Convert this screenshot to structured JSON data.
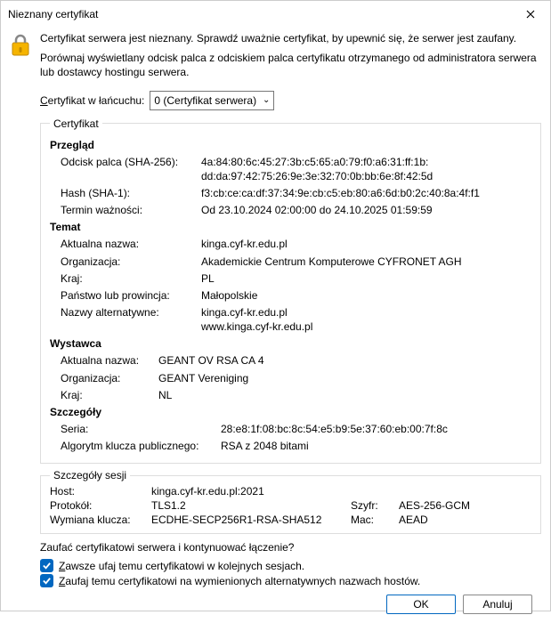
{
  "window": {
    "title": "Nieznany certyfikat"
  },
  "intro": {
    "line1": "Certyfikat serwera jest nieznany. Sprawdź uważnie certyfikat, by upewnić się, że serwer jest zaufany.",
    "line2": "Porównaj wyświetlany odcisk palca z odciskiem palca certyfikatu otrzymanego od administratora serwera lub dostawcy hostingu serwera."
  },
  "chain": {
    "label_pre": "C",
    "label_rest": "ertyfikat w łańcuchu:",
    "selected": "0 (Certyfikat serwera)"
  },
  "cert": {
    "legend": "Certyfikat",
    "overview": {
      "title": "Przegląd",
      "fingerprint_label": "Odcisk palca (SHA-256):",
      "fingerprint_l1": "4a:84:80:6c:45:27:3b:c5:65:a0:79:f0:a6:31:ff:1b:",
      "fingerprint_l2": "dd:da:97:42:75:26:9e:3e:32:70:0b:bb:6e:8f:42:5d",
      "hash_label": "Hash (SHA-1):",
      "hash": "f3:cb:ce:ca:df:37:34:9e:cb:c5:eb:80:a6:6d:b0:2c:40:8a:4f:f1",
      "validity_label": "Termin ważności:",
      "validity": "Od 23.10.2024 02:00:00 do 24.10.2025 01:59:59"
    },
    "subject": {
      "title": "Temat",
      "cn_label": "Aktualna nazwa:",
      "cn": "kinga.cyf-kr.edu.pl",
      "org_label": "Organizacja:",
      "org": "Akademickie Centrum Komputerowe CYFRONET AGH",
      "country_label": "Kraj:",
      "country": "PL",
      "state_label": "Państwo lub prowincja:",
      "state": "Małopolskie",
      "san_label": "Nazwy alternatywne:",
      "san1": "kinga.cyf-kr.edu.pl",
      "san2": "www.kinga.cyf-kr.edu.pl"
    },
    "issuer": {
      "title": "Wystawca",
      "cn_label": "Aktualna nazwa:",
      "cn": "GEANT OV RSA CA 4",
      "org_label": "Organizacja:",
      "org": "GEANT Vereniging",
      "country_label": "Kraj:",
      "country": "NL"
    },
    "details": {
      "title": "Szczegóły",
      "serial_label": "Seria:",
      "serial": "28:e8:1f:08:bc:8c:54:e5:b9:5e:37:60:eb:00:7f:8c",
      "pkalg_label": "Algorytm klucza publicznego:",
      "pkalg": "RSA z 2048 bitami"
    }
  },
  "session": {
    "legend": "Szczegóły sesji",
    "host_label": "Host:",
    "host": "kinga.cyf-kr.edu.pl:2021",
    "proto_label": "Protokół:",
    "proto": "TLS1.2",
    "cipher_label": "Szyfr:",
    "cipher": "AES-256-GCM",
    "kex_label": "Wymiana klucza:",
    "kex": "ECDHE-SECP256R1-RSA-SHA512",
    "mac_label": "Mac:",
    "mac": "AEAD"
  },
  "question": "Zaufać certyfikatowi serwera i kontynuować łączenie?",
  "cb1": {
    "pre": "Z",
    "rest": "awsze ufaj temu certyfikatowi w kolejnych sesjach."
  },
  "cb2": {
    "pre": "Z",
    "rest": "aufaj temu certyfikatowi na wymienionych alternatywnych nazwach hostów."
  },
  "buttons": {
    "ok": "OK",
    "cancel": "Anuluj"
  }
}
